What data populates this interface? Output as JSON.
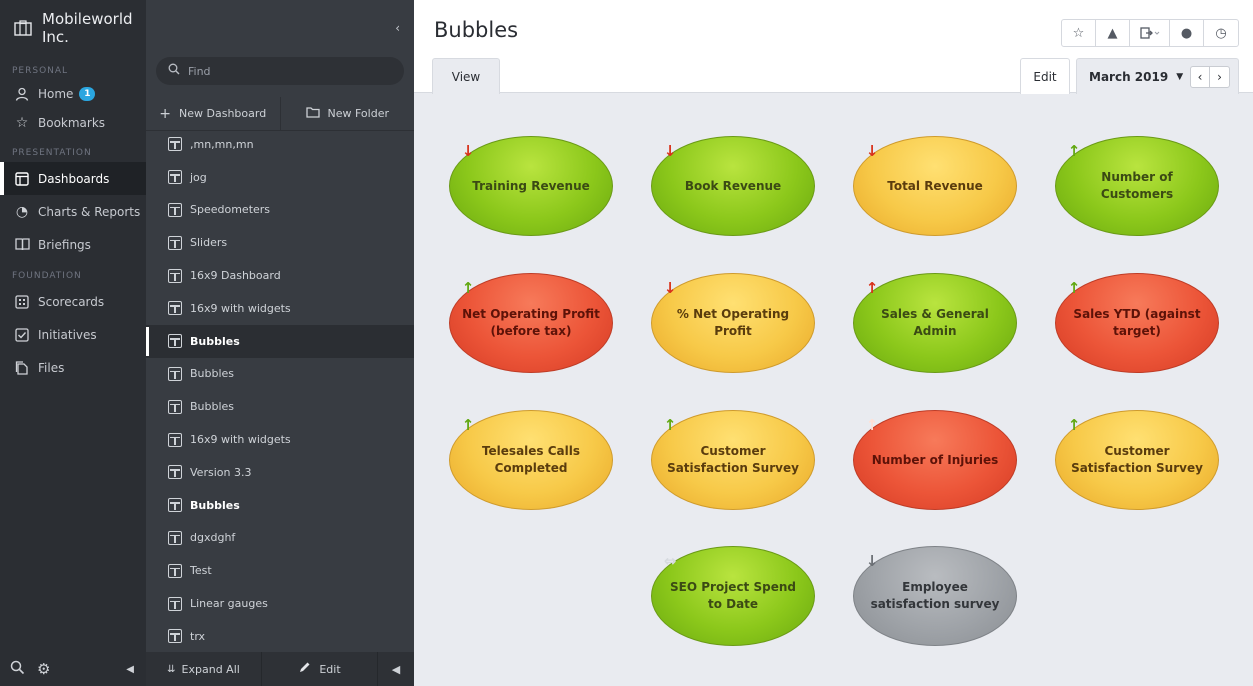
{
  "nav": {
    "org_name": "Mobileworld Inc.",
    "sections": {
      "personal": "PERSONAL",
      "presentation": "PRESENTATION",
      "foundation": "FOUNDATION"
    },
    "items": {
      "home": "Home",
      "home_badge": "1",
      "bookmarks": "Bookmarks",
      "dashboards": "Dashboards",
      "charts_reports": "Charts & Reports",
      "briefings": "Briefings",
      "scorecards": "Scorecards",
      "initiatives": "Initiatives",
      "files": "Files"
    }
  },
  "list": {
    "find_placeholder": "Find",
    "new_dashboard": "New Dashboard",
    "new_folder": "New Folder",
    "rows": [
      ",mn,mn,mn",
      "jog",
      "Speedometers",
      "Sliders",
      "16x9 Dashboard",
      "16x9 with widgets",
      "Bubbles",
      "Bubbles",
      "Bubbles",
      "16x9 with widgets",
      "Version 3.3",
      "Bubbles",
      "dgxdghf",
      "Test",
      "Linear gauges",
      "trx"
    ],
    "expand_all": "Expand All",
    "edit": "Edit"
  },
  "main": {
    "title": "Bubbles",
    "tab_view": "View",
    "edit": "Edit",
    "date": "March 2019"
  },
  "bubbles": {
    "b1": "Training Revenue",
    "b2": "Book Revenue",
    "b3": "Total Revenue",
    "b4": "Number of Customers",
    "b5": "Net Operating Profit (before tax)",
    "b6": "% Net Operating Profit",
    "b7": "Sales & General Admin",
    "b8": "Sales YTD (against target)",
    "b9": "Telesales Calls Completed",
    "b10": "Customer Satisfaction Survey",
    "b11": "Number of Injuries",
    "b12": "Customer Satisfaction Survey",
    "b13": "SEO Project Spend to Date",
    "b14": "Employee satisfaction survey"
  },
  "colors": {
    "green": "#8cc81b",
    "yellow": "#f7c948",
    "red": "#ec5538",
    "gray": "#9fa3a8",
    "badge": "#2aa6e0"
  }
}
